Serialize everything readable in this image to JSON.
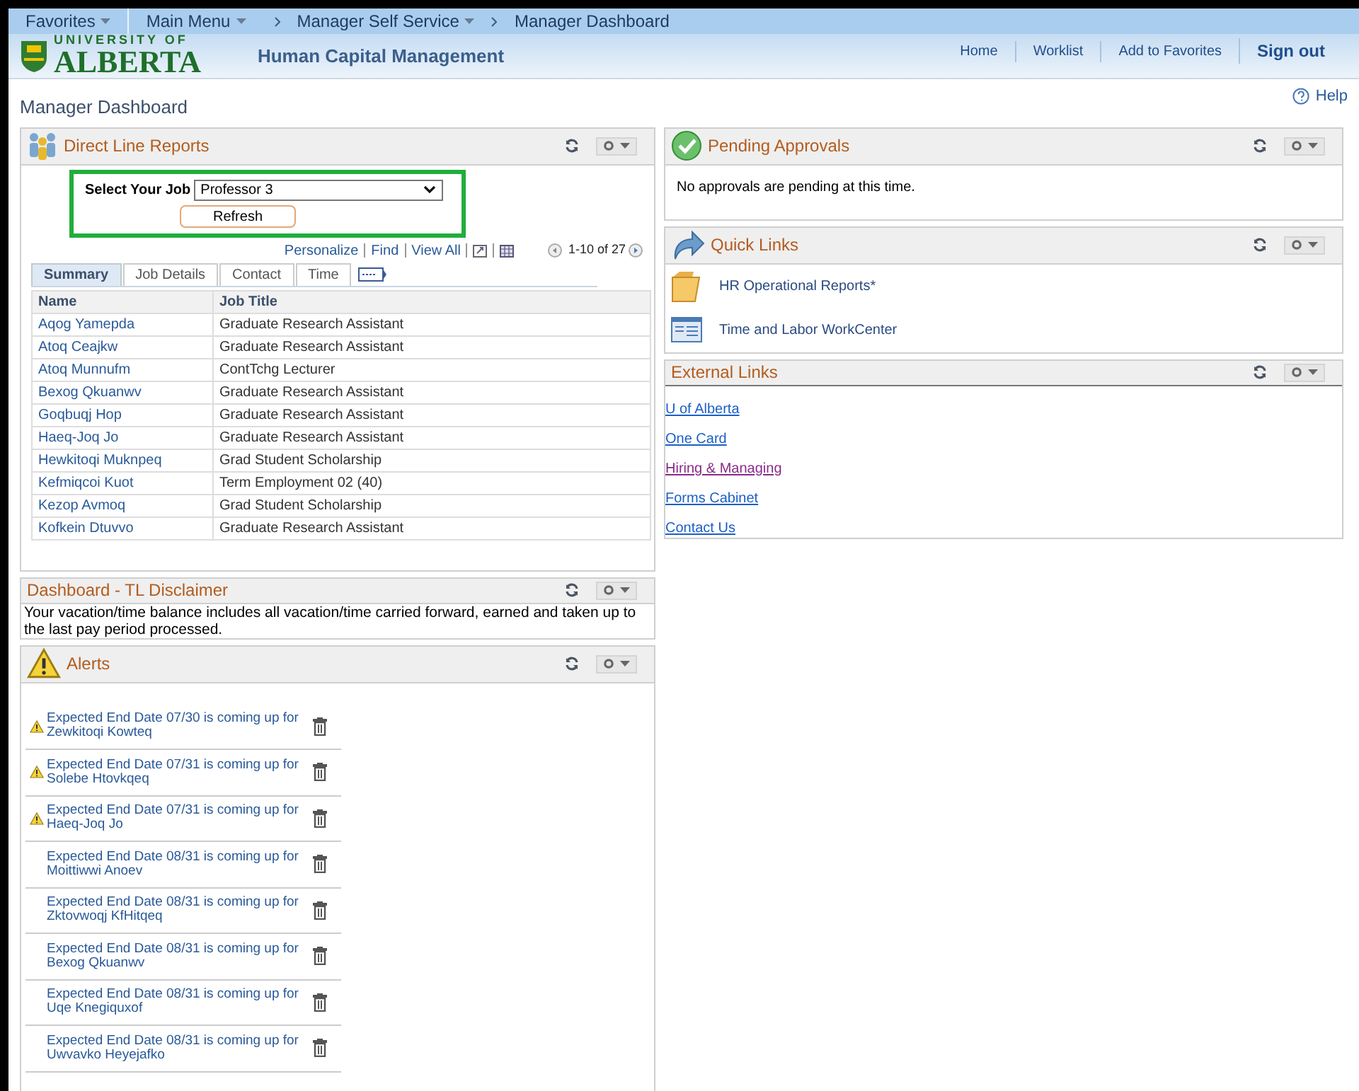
{
  "nav": {
    "items": [
      {
        "label": "Favorites",
        "kind": "menu"
      },
      {
        "label": "Main Menu",
        "kind": "menu"
      }
    ],
    "breadcrumbs": [
      {
        "label": "Manager Self Service",
        "dropdown": true
      },
      {
        "label": "Manager Dashboard",
        "dropdown": false
      }
    ]
  },
  "header": {
    "logo_top": "UNIVERSITY OF",
    "logo_main": "ALBERTA",
    "app_title": "Human Capital Management",
    "links": [
      {
        "label": "Home",
        "bold": false
      },
      {
        "label": "Worklist",
        "bold": false
      },
      {
        "label": "Add to Favorites",
        "bold": false
      },
      {
        "label": "Sign out",
        "bold": true
      }
    ]
  },
  "page": {
    "title": "Manager Dashboard",
    "help": "Help"
  },
  "direct_line_reports": {
    "title": "Direct Line Reports",
    "job_label": "Select Your Job",
    "job_value": "Professor 3",
    "refresh": "Refresh",
    "grid_links": [
      "Personalize",
      "Find",
      "View All"
    ],
    "pager": "1-10 of 27",
    "tabs": [
      {
        "label": "Summary",
        "selected": true
      },
      {
        "label": "Job Details",
        "selected": false
      },
      {
        "label": "Contact",
        "selected": false
      },
      {
        "label": "Time",
        "selected": false
      }
    ],
    "columns": [
      "Name",
      "Job Title"
    ],
    "rows": [
      [
        "Aqog Yamepda",
        "Graduate Research Assistant"
      ],
      [
        "Atoq Ceajkw",
        "Graduate Research Assistant"
      ],
      [
        "Atoq Munnufm",
        "ContTchg Lecturer"
      ],
      [
        "Bexog Qkuanwv",
        "Graduate Research Assistant"
      ],
      [
        "Goqbuqj Hop",
        "Graduate Research Assistant"
      ],
      [
        "Haeq-Joq Jo",
        "Graduate Research Assistant"
      ],
      [
        "Hewkitoqi Muknpeq",
        "Grad Student Scholarship"
      ],
      [
        "Kefmiqcoi Kuot",
        "Term Employment 02 (40)"
      ],
      [
        "Kezop Avmoq",
        "Grad Student Scholarship"
      ],
      [
        "Kofkein Dtuvvo",
        "Graduate Research Assistant"
      ]
    ]
  },
  "disclaimer": {
    "title": "Dashboard - TL Disclaimer",
    "text": "Your vacation/time balance includes all vacation/time carried forward, earned and taken up to the last pay period processed."
  },
  "alerts": {
    "title": "Alerts",
    "items": [
      {
        "text": "Expected End Date 07/30 is coming up for Zewkitoqi Kowteq",
        "warning": true
      },
      {
        "text": "Expected End Date 07/31 is coming up for Solebe Htovkqeq",
        "warning": true
      },
      {
        "text": "Expected End Date 07/31 is coming up for Haeq-Joq Jo",
        "warning": true
      },
      {
        "text": "Expected End Date 08/31 is coming up for Moittiwwi Anoev",
        "warning": false
      },
      {
        "text": "Expected End Date 08/31 is coming up for Zktovwoqj KfHitqeq",
        "warning": false
      },
      {
        "text": "Expected End Date 08/31 is coming up for Bexog Qkuanwv",
        "warning": false
      },
      {
        "text": "Expected End Date 08/31 is coming up for Uqe Knegiquxof",
        "warning": false
      },
      {
        "text": "Expected End Date 08/31 is coming up for Uwvavko Heyejafko",
        "warning": false
      }
    ]
  },
  "pending_approvals": {
    "title": "Pending Approvals",
    "text": "No approvals are pending at this time."
  },
  "quick_links": {
    "title": "Quick Links",
    "items": [
      {
        "label": "HR Operational Reports*",
        "kind": "folder"
      },
      {
        "label": "Time and Labor WorkCenter",
        "kind": "workcenter"
      }
    ]
  },
  "external_links": {
    "title": "External Links",
    "items": [
      {
        "label": "U of Alberta",
        "visited": false
      },
      {
        "label": "One Card",
        "visited": false
      },
      {
        "label": "Hiring & Managing",
        "visited": true
      },
      {
        "label": "Forms Cabinet",
        "visited": false
      },
      {
        "label": "Contact Us",
        "visited": false
      }
    ]
  }
}
